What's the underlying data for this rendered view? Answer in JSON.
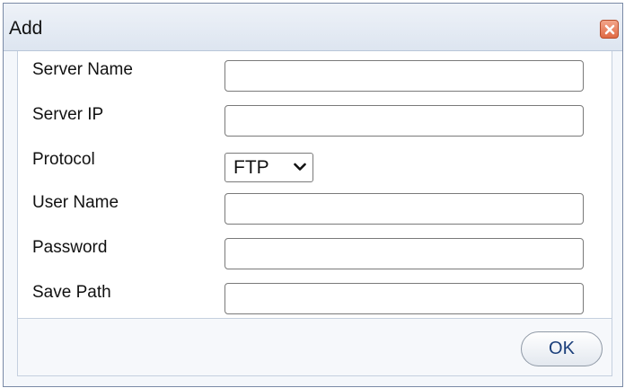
{
  "dialog": {
    "title": "Add",
    "close_icon": "close-icon",
    "close_color": "#e06a45"
  },
  "form": {
    "server_name": {
      "label": "Server Name",
      "value": ""
    },
    "server_ip": {
      "label": "Server IP",
      "value": ""
    },
    "protocol": {
      "label": "Protocol",
      "selected": "FTP"
    },
    "user_name": {
      "label": "User Name",
      "value": ""
    },
    "password": {
      "label": "Password",
      "value": ""
    },
    "save_path": {
      "label": "Save Path",
      "value": ""
    }
  },
  "footer": {
    "ok_label": "OK"
  }
}
